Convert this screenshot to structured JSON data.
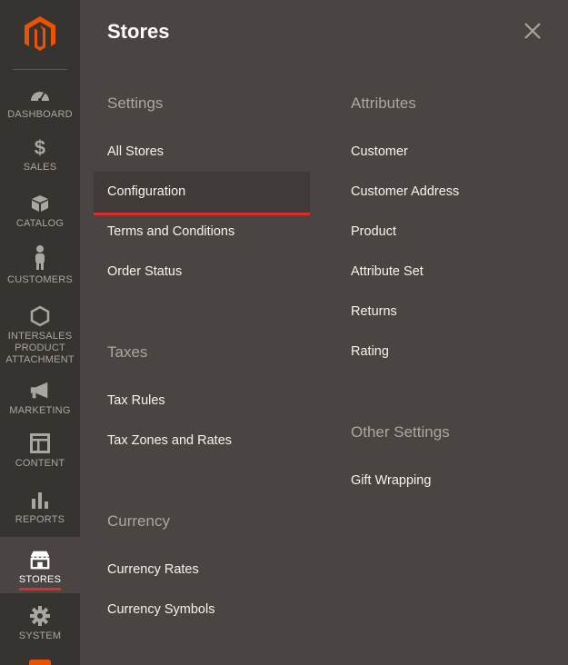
{
  "sidebar": {
    "items": [
      {
        "key": "dashboard",
        "label": "DASHBOARD",
        "icon": "dashboard-gauge-icon"
      },
      {
        "key": "sales",
        "label": "SALES",
        "icon": "dollar-icon"
      },
      {
        "key": "catalog",
        "label": "CATALOG",
        "icon": "box-icon"
      },
      {
        "key": "customers",
        "label": "CUSTOMERS",
        "icon": "person-icon"
      },
      {
        "key": "intersales",
        "label": "INTERSALES\nPRODUCT\nATTACHMENT",
        "icon": "hexagon-icon"
      },
      {
        "key": "marketing",
        "label": "MARKETING",
        "icon": "megaphone-icon"
      },
      {
        "key": "content",
        "label": "CONTENT",
        "icon": "layout-icon"
      },
      {
        "key": "reports",
        "label": "REPORTS",
        "icon": "bar-chart-icon"
      },
      {
        "key": "stores",
        "label": "STORES",
        "icon": "storefront-icon",
        "active": true
      },
      {
        "key": "system",
        "label": "SYSTEM",
        "icon": "gear-icon"
      }
    ]
  },
  "panel": {
    "title": "Stores",
    "sections": {
      "settings": {
        "heading": "Settings",
        "links": [
          "All Stores",
          "Configuration",
          "Terms and Conditions",
          "Order Status"
        ]
      },
      "taxes": {
        "heading": "Taxes",
        "links": [
          "Tax Rules",
          "Tax Zones and Rates"
        ]
      },
      "currency": {
        "heading": "Currency",
        "links": [
          "Currency Rates",
          "Currency Symbols"
        ]
      },
      "attributes": {
        "heading": "Attributes",
        "links": [
          "Customer",
          "Customer Address",
          "Product",
          "Attribute Set",
          "Returns",
          "Rating"
        ]
      },
      "other": {
        "heading": "Other Settings",
        "links": [
          "Gift Wrapping"
        ]
      }
    },
    "selected_link": "Configuration"
  },
  "colors": {
    "sidebar_bg": "#373330",
    "panel_bg": "#4a4542",
    "accent_red": "#e02b27",
    "brand_orange": "#eb5202"
  }
}
